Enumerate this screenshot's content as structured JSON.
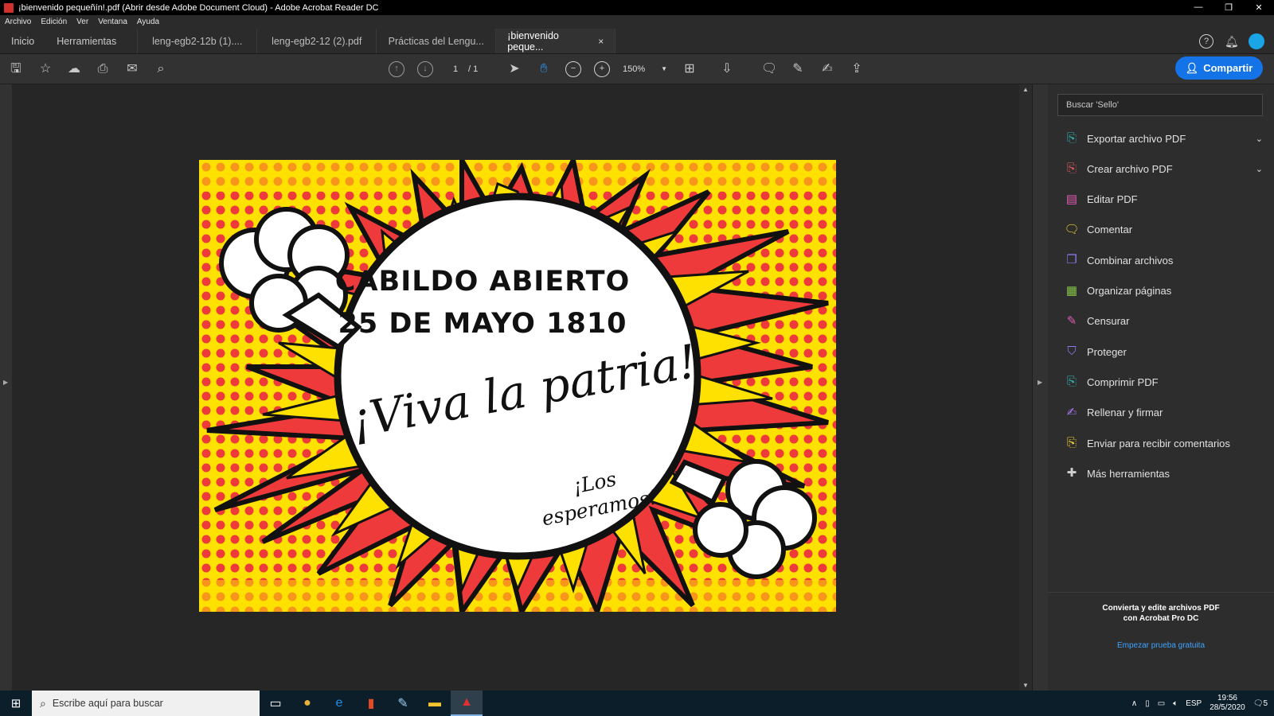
{
  "window": {
    "title": "¡bienvenido pequeñín!.pdf (Abrir desde Adobe Document Cloud) - Adobe Acrobat Reader DC",
    "controls": [
      "—",
      "❐",
      "✕"
    ]
  },
  "menu": [
    "Archivo",
    "Edición",
    "Ver",
    "Ventana",
    "Ayuda"
  ],
  "tabs": {
    "home": "Inicio",
    "tools": "Herramientas",
    "docs": [
      "leng-egb2-12b (1)....",
      "leng-egb2-12 (2).pdf",
      "Prácticas del Lengu...",
      "¡bienvenido peque..."
    ],
    "close": "×"
  },
  "toolbar": {
    "page_current": "1",
    "page_total": "/ 1",
    "zoom": "150%",
    "share_label": "Compartir",
    "help_glyph": "?"
  },
  "document": {
    "line1": "CABILDO ABIERTO",
    "line2": "25 DE MAYO 1810",
    "script1": "¡Viva la patria!",
    "script2a": "¡Los",
    "script2b": "esperamos!"
  },
  "panel": {
    "search_placeholder": "Buscar 'Sello'",
    "tools": [
      {
        "label": "Exportar archivo PDF",
        "icon": "export-pdf-icon",
        "color": "#36b3b3",
        "expand": true
      },
      {
        "label": "Crear archivo PDF",
        "icon": "create-pdf-icon",
        "color": "#e25a67",
        "expand": true
      },
      {
        "label": "Editar PDF",
        "icon": "edit-pdf-icon",
        "color": "#e05ab0",
        "expand": false
      },
      {
        "label": "Comentar",
        "icon": "comment-icon",
        "color": "#f2d230",
        "expand": false
      },
      {
        "label": "Combinar archivos",
        "icon": "combine-files-icon",
        "color": "#8a7af2",
        "expand": false
      },
      {
        "label": "Organizar páginas",
        "icon": "organize-pages-icon",
        "color": "#86c24a",
        "expand": false
      },
      {
        "label": "Censurar",
        "icon": "redact-icon",
        "color": "#e05ab0",
        "expand": false
      },
      {
        "label": "Proteger",
        "icon": "protect-icon",
        "color": "#8a7af2",
        "expand": false
      },
      {
        "label": "Comprimir PDF",
        "icon": "compress-pdf-icon",
        "color": "#36b3b3",
        "expand": false
      },
      {
        "label": "Rellenar y firmar",
        "icon": "fill-sign-icon",
        "color": "#a87af2",
        "expand": false
      },
      {
        "label": "Enviar para recibir comentarios",
        "icon": "send-review-icon",
        "color": "#f2d230",
        "expand": false
      },
      {
        "label": "Más herramientas",
        "icon": "more-tools-icon",
        "color": "#cfcfcf",
        "expand": false
      }
    ],
    "promo_line1": "Convierta y edite archivos PDF",
    "promo_line2": "con Acrobat Pro DC",
    "promo_link": "Empezar prueba gratuita"
  },
  "taskbar": {
    "search_placeholder": "Escribe aquí para buscar",
    "lang": "ESP",
    "time": "19:56",
    "date": "28/5/2020",
    "notifications": "5"
  },
  "colors": {
    "accent": "#1473e6",
    "poster_yellow": "#ffe100",
    "poster_red": "#ee3a3a"
  }
}
